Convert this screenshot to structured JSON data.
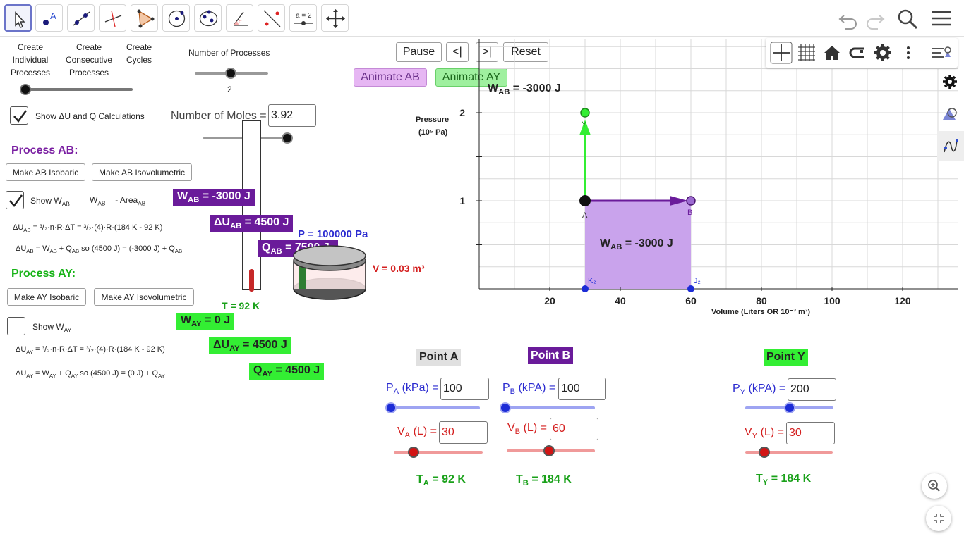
{
  "toolbar": {
    "tools": [
      "move-tool",
      "point-tool",
      "line-tool",
      "perpendicular-tool",
      "polygon-tool",
      "circle-tool",
      "ellipse-tool",
      "angle-tool",
      "reflect-tool",
      "slider-tool",
      "move-view-tool"
    ],
    "slider_tool_label": "a = 2",
    "icons": [
      "undo-icon",
      "redo-icon",
      "search-icon",
      "menu-icon"
    ]
  },
  "left": {
    "create_individual": "Create Individual Processes",
    "create_individual_lines": [
      "Create",
      "Individual",
      "Processes"
    ],
    "create_consecutive_lines": [
      "Create",
      "Consecutive",
      "Processes"
    ],
    "create_cycles_lines": [
      "Create",
      "Cycles"
    ],
    "num_processes_label": "Number of Processes",
    "num_processes_value": "2",
    "show_calcs_label": "Show ΔU and Q Calculations",
    "num_moles_label": "Number of Moles =",
    "num_moles_value": "3.92",
    "process_ab_header": "Process AB:",
    "make_ab_isobaric": "Make AB Isobaric",
    "make_ab_isovolumetric": "Make AB Isovolumetric",
    "show_wab": "Show W",
    "wab_area_formula": "W = - Area",
    "wab_box": "W = -3000 J",
    "du_ab_box": "ΔU =  4500  J",
    "q_ab_box": "Q = 7500 J",
    "du_ab_formula": "ΔU = ³/₂·n·R·ΔT  =  ³/₂·(4)·R·(184 K - 92 K)",
    "du_ab_relation": "ΔU = W + Q   so  (4500 J) = (-3000 J) + Q",
    "process_ay_header": "Process AY:",
    "make_ay_isobaric": "Make AY Isobaric",
    "make_ay_isovolumetric": "Make AY Isovolumetric",
    "show_way": "Show W",
    "way_box": "W = 0 J",
    "du_ay_box": "ΔU =  4500  J",
    "q_ay_box": "Q =  4500  J",
    "du_ay_formula": "ΔU = ³/₂·n·R·ΔT  =  ³/₂·(4)·R·(184 K -  92 K)",
    "du_ay_relation": "ΔU = W + Q    so   (4500 J)  =  (0 J)  +  Q",
    "temperature": "T = 92 K",
    "pressure_readout": "P = 100000 Pa",
    "volume_readout": "V = 0.03 m³"
  },
  "animation": {
    "pause": "Pause",
    "step_back": "<|",
    "step_forward": ">|",
    "reset": "Reset",
    "animate_ab": "Animate AB",
    "animate_ay": "Animate AY"
  },
  "graph": {
    "y_axis_label": "Pressure",
    "y_axis_unit": "(10⁵ Pa)",
    "x_axis_label": "Volume  (Liters  OR  10⁻³  m³)",
    "x_ticks": [
      "20",
      "40",
      "60",
      "80",
      "100",
      "120"
    ],
    "y_ticks": [
      "1",
      "2"
    ],
    "w_top_label": "W = -3000 J",
    "w_area_label": "W = -3000 J",
    "point_labels": [
      "A",
      "B",
      "Y",
      "K₂",
      "J₂"
    ],
    "colors": {
      "process_ab": "#6a1b9a",
      "process_ay": "#33ee33",
      "area": "#c9a3ec"
    }
  },
  "chart_data": {
    "type": "line",
    "xlabel": "Volume  (Liters  OR  10⁻³  m³)",
    "ylabel": "Pressure (10⁵ Pa)",
    "series": [
      {
        "name": "Process AB",
        "x": [
          30,
          60
        ],
        "y": [
          1,
          1
        ]
      },
      {
        "name": "Process AY",
        "x": [
          30,
          30
        ],
        "y": [
          1,
          2
        ]
      }
    ]
  },
  "points": {
    "a": {
      "title": "Point A",
      "p_label": "P (kPa) =",
      "p_value": "100",
      "v_label": "V (L) =",
      "v_value": "30",
      "t_label": "T = 92 K",
      "p_fraction": 0.0,
      "v_fraction": 0.22
    },
    "b": {
      "title": "Point B",
      "p_label": "P (kPa) =",
      "p_value": "100",
      "v_label": "V (L) =",
      "v_value": "60",
      "t_label": "T = 184  K",
      "p_fraction": 0.0,
      "v_fraction": 0.48
    },
    "y": {
      "title": "Point Y",
      "p_label": "P (kPa) =",
      "p_value": "200",
      "v_label": "V (L) =",
      "v_value": "30",
      "t_label": "T =  184 K",
      "p_fraction": 0.5,
      "v_fraction": 0.22
    }
  },
  "panel_icons": [
    "settings-icon",
    "shapes-icon",
    "graph-icon",
    "zoom-in-icon",
    "fullscreen-icon"
  ],
  "graph_toolbar_icons": [
    "axes-icon",
    "grid-icon",
    "home-icon",
    "point-capture-icon",
    "settings-icon",
    "more-icon",
    "style-bar-icon"
  ]
}
